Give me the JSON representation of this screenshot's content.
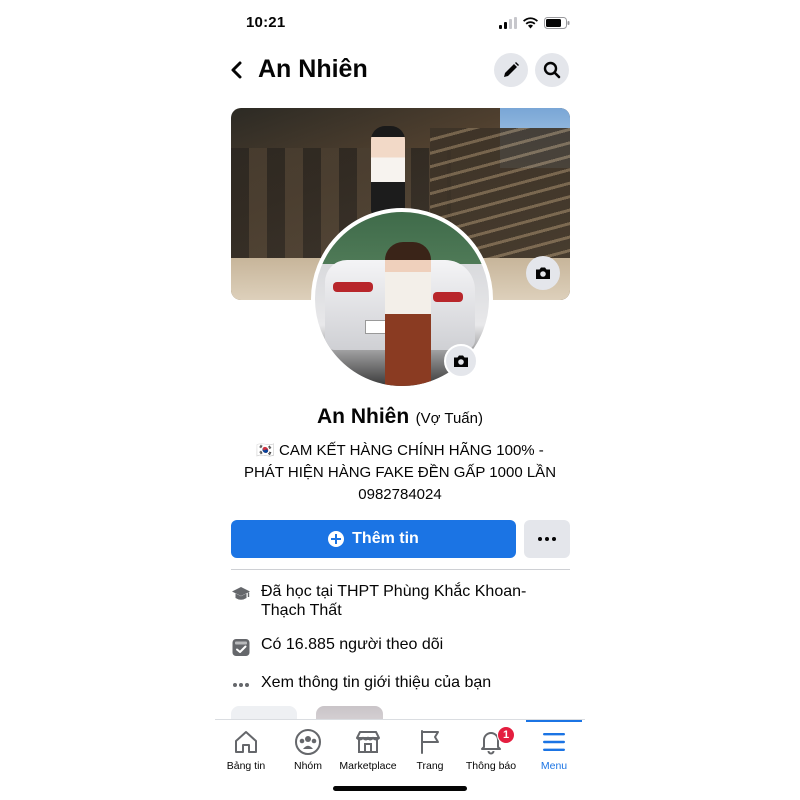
{
  "status_bar": {
    "time": "10:21"
  },
  "header": {
    "title": "An Nhiên"
  },
  "profile": {
    "name": "An Nhiên",
    "alternate_name": "(Vợ Tuấn)",
    "bio_line1": "🇰🇷 CAM KẾT HÀNG CHÍNH HÃNG 100% -",
    "bio_line2": "PHÁT HIỆN HÀNG FAKE ĐỀN GẤP 1000 LẦN",
    "bio_line3": "0982784024"
  },
  "actions": {
    "add_story_label": "Thêm tin"
  },
  "info": {
    "education": "Đã học tại THPT Phùng Khắc Khoan-Thạch Thất",
    "followers": "Có 16.885 người theo dõi",
    "about": "Xem thông tin giới thiệu của bạn"
  },
  "tabs": [
    {
      "label": "Bảng tin",
      "icon": "home-icon"
    },
    {
      "label": "Nhóm",
      "icon": "groups-icon"
    },
    {
      "label": "Marketplace",
      "icon": "marketplace-icon"
    },
    {
      "label": "Trang",
      "icon": "pages-flag-icon"
    },
    {
      "label": "Thông báo",
      "icon": "bell-icon",
      "badge": "1"
    },
    {
      "label": "Menu",
      "icon": "menu-icon",
      "active": true
    }
  ],
  "colors": {
    "accent": "#1b74e4",
    "badge": "#e41e3f",
    "button_gray": "#e4e6eb"
  }
}
